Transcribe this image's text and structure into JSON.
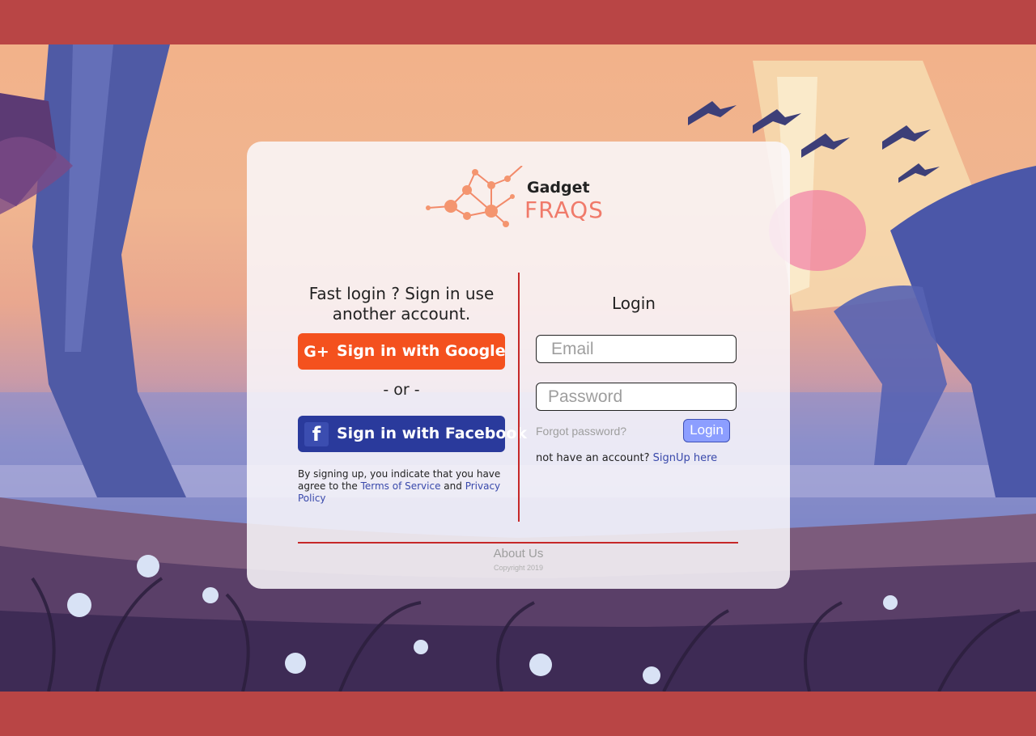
{
  "brand": {
    "name_line1": "Gadget",
    "name_line2": "FRAQS"
  },
  "social": {
    "title": "Fast login ? Sign in use another account.",
    "google_label": "Sign in with Google",
    "google_icon_text": "G+",
    "or_text": "- or -",
    "facebook_label": "Sign in with Facebook",
    "facebook_icon_text": "f",
    "terms_prefix": "By signing up, you indicate that you have agree to the ",
    "terms_link": "Terms of Service",
    "terms_and": " and ",
    "privacy_link": "Privacy Policy"
  },
  "login": {
    "title": "Login",
    "email_placeholder": "Email",
    "password_placeholder": "Password",
    "forgot_label": "Forgot password?",
    "login_button": "Login",
    "signup_prefix": "not have an account? ",
    "signup_link": "SignUp here"
  },
  "footer": {
    "about": "About Us",
    "copyright": "Copyright 2019"
  },
  "colors": {
    "frame": "#b94545",
    "google": "#f4511e",
    "facebook": "#2a3a9c",
    "divider": "#c62828",
    "link": "#3949ab",
    "login_button": "#8c9eff"
  }
}
